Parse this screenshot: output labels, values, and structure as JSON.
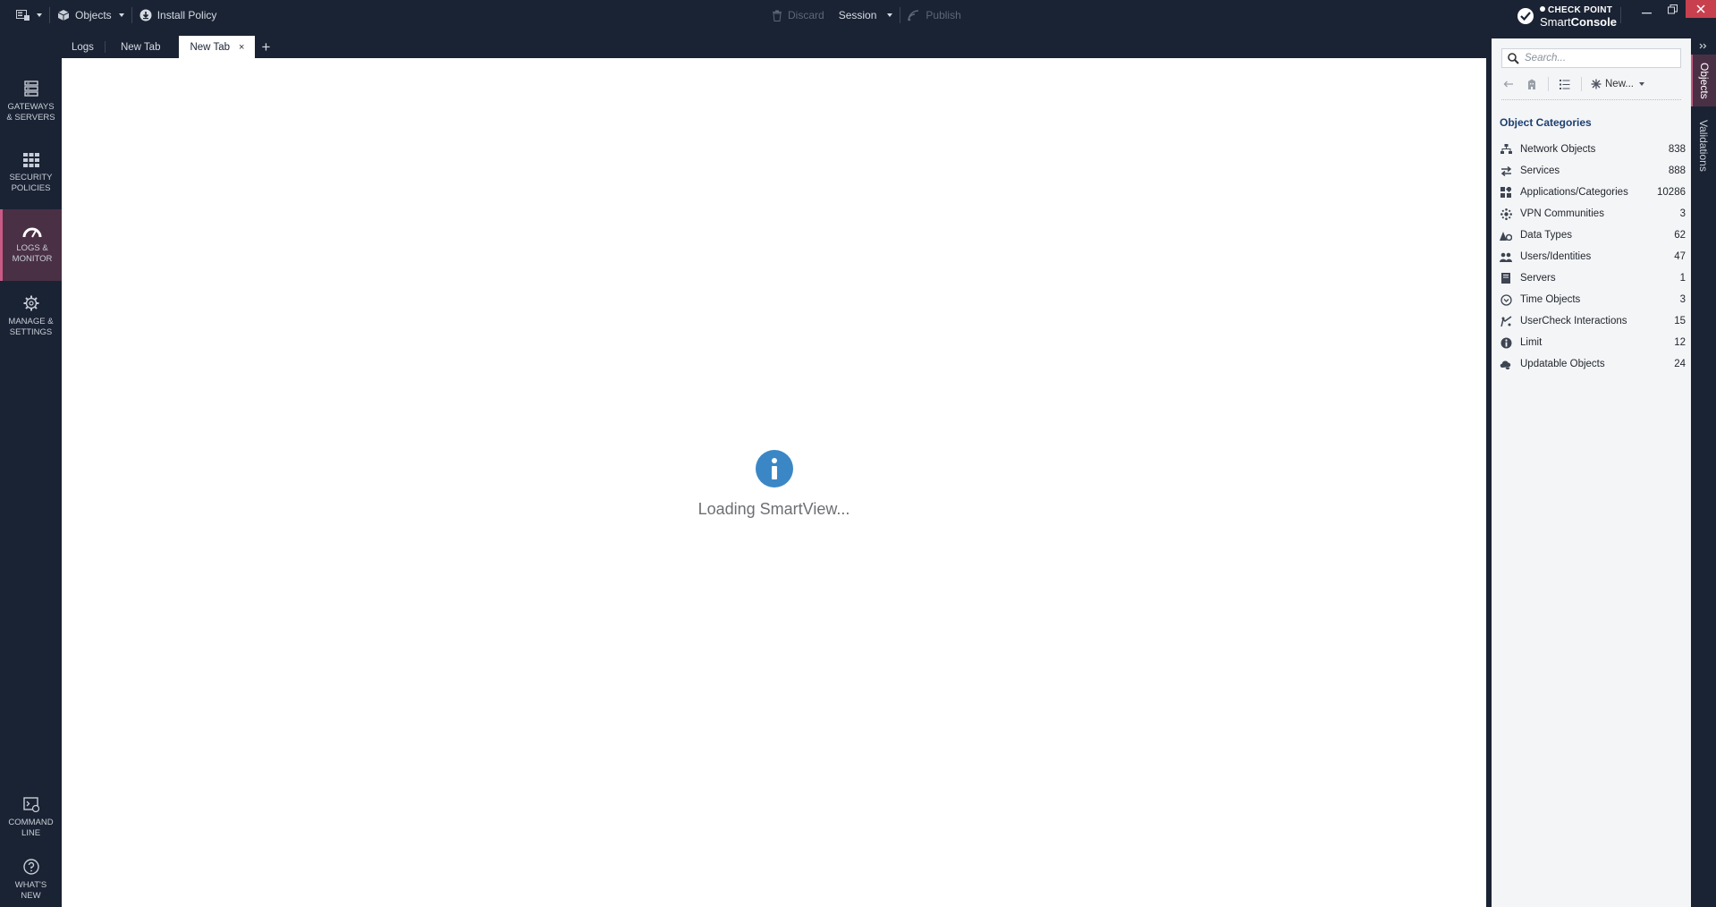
{
  "topbar": {
    "objects_label": "Objects",
    "install_policy_label": "Install Policy",
    "discard_label": "Discard",
    "session_label": "Session",
    "publish_label": "Publish"
  },
  "brand": {
    "top": "CHECK POINT",
    "bottom_light": "Smart",
    "bottom_bold": "Console"
  },
  "leftnav": {
    "items": [
      {
        "line1": "GATEWAYS",
        "line2": "& SERVERS"
      },
      {
        "line1": "SECURITY",
        "line2": "POLICIES"
      },
      {
        "line1": "LOGS &",
        "line2": "MONITOR"
      },
      {
        "line1": "MANAGE &",
        "line2": "SETTINGS"
      },
      {
        "line1": "COMMAND",
        "line2": "LINE"
      },
      {
        "line1": "WHAT'S",
        "line2": "NEW"
      }
    ]
  },
  "tabs": [
    {
      "label": "Logs"
    },
    {
      "label": "New Tab"
    },
    {
      "label": "New Tab",
      "close": "×"
    }
  ],
  "tab_add": "+",
  "main": {
    "loading_text": "Loading SmartView..."
  },
  "rpanel": {
    "search_placeholder": "Search...",
    "new_label": "New...",
    "categories_title": "Object Categories",
    "categories": [
      {
        "name": "Network Objects",
        "count": "838",
        "icon": "network-objects-icon"
      },
      {
        "name": "Services",
        "count": "888",
        "icon": "services-icon"
      },
      {
        "name": "Applications/Categories",
        "count": "10286",
        "icon": "applications-icon"
      },
      {
        "name": "VPN Communities",
        "count": "3",
        "icon": "vpn-icon"
      },
      {
        "name": "Data Types",
        "count": "62",
        "icon": "data-types-icon"
      },
      {
        "name": "Users/Identities",
        "count": "47",
        "icon": "users-icon"
      },
      {
        "name": "Servers",
        "count": "1",
        "icon": "servers-icon"
      },
      {
        "name": "Time Objects",
        "count": "3",
        "icon": "time-icon"
      },
      {
        "name": "UserCheck Interactions",
        "count": "15",
        "icon": "usercheck-icon"
      },
      {
        "name": "Limit",
        "count": "12",
        "icon": "limit-icon"
      },
      {
        "name": "Updatable Objects",
        "count": "24",
        "icon": "updatable-icon"
      }
    ]
  },
  "vtabs": {
    "objects": "Objects",
    "validations": "Validations"
  },
  "colors": {
    "chrome_bg": "#1a2333",
    "accent_active": "#c85a85",
    "info_blue": "#3b87c6",
    "category_title": "#1c3f70",
    "close_red": "#c8404e"
  }
}
